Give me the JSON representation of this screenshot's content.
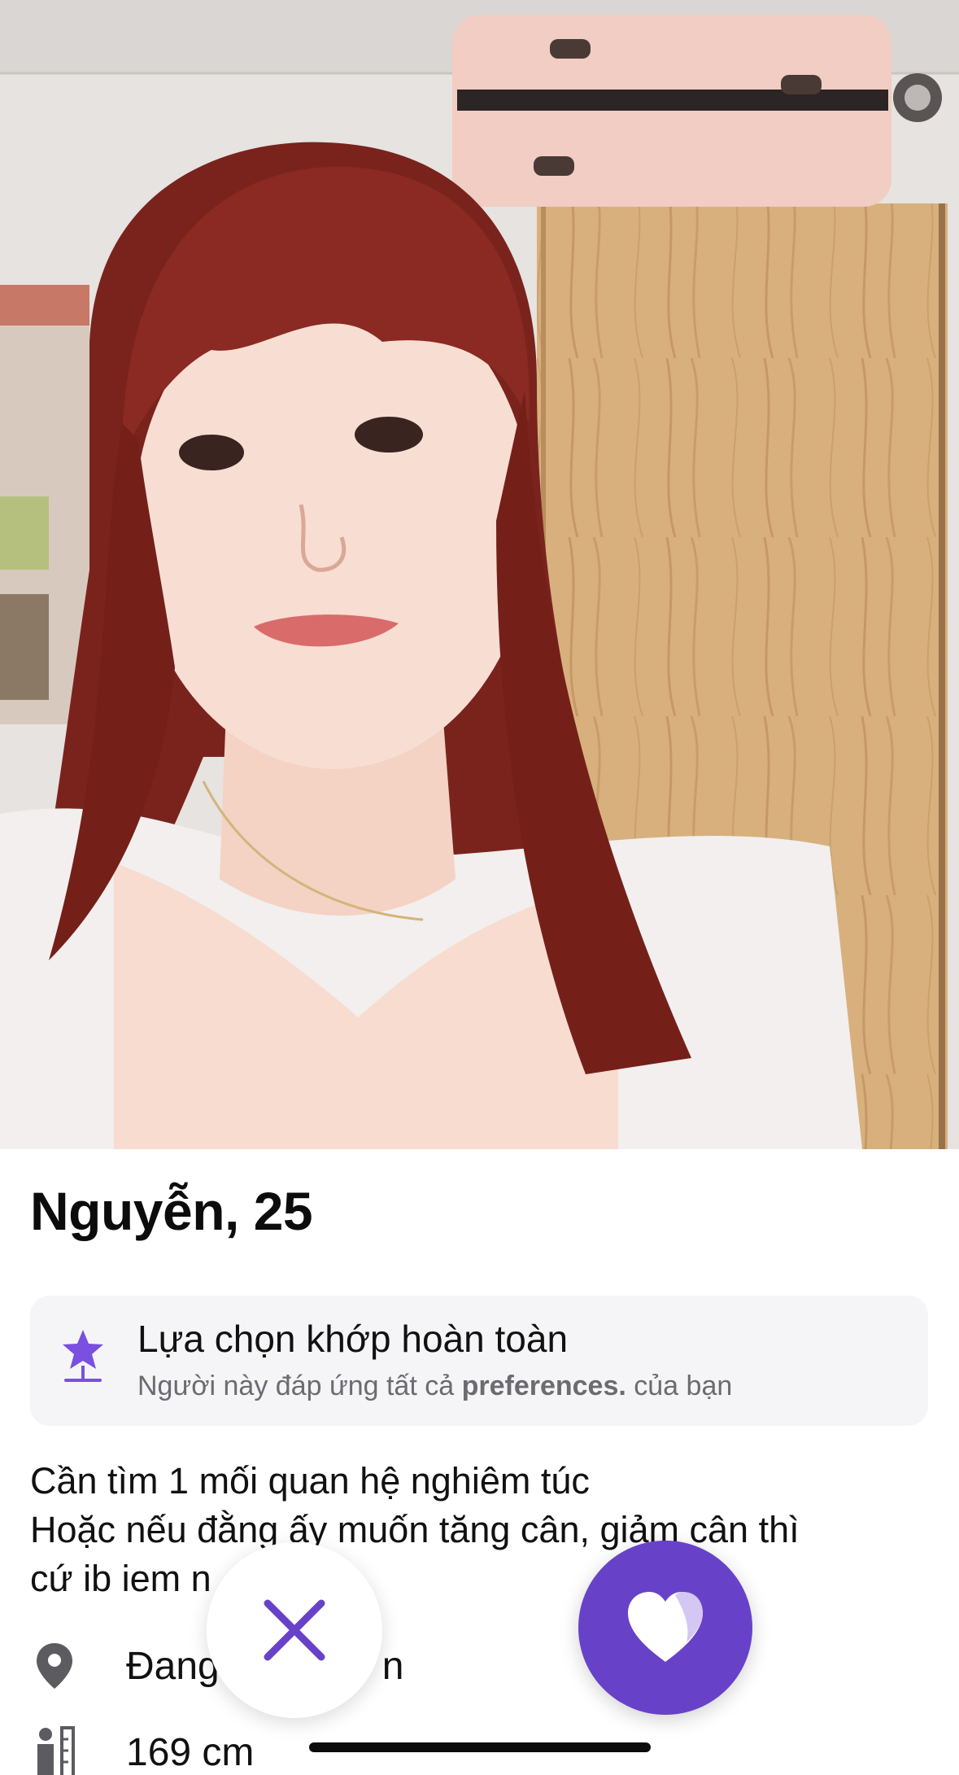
{
  "profile": {
    "name_age": "Nguyễn, 25"
  },
  "match_card": {
    "icon": "star-badge-icon",
    "title": "Lựa chọn khớp hoàn toàn",
    "subtitle_prefix": "Người này đáp ứng tất cả ",
    "subtitle_bold": "preferences.",
    "subtitle_suffix": " của bạn"
  },
  "bio": {
    "text": "Cần tìm 1 mối quan hệ nghiêm túc\nHoặc nếu đằng ấy muốn tăng cân, giảm cân thì\ncứ ib iem n"
  },
  "details": {
    "location_icon": "location-pin-icon",
    "location_text": "Đang",
    "location_tail": "n",
    "height_icon": "height-ruler-icon",
    "height_text": "169 cm"
  },
  "actions": {
    "pass_icon": "close-icon",
    "like_icon": "heart-icon"
  },
  "colors": {
    "accent": "#6742c9",
    "star": "#7b4fe0",
    "card_bg": "#f5f5f7",
    "subtext": "#6b6b70"
  }
}
